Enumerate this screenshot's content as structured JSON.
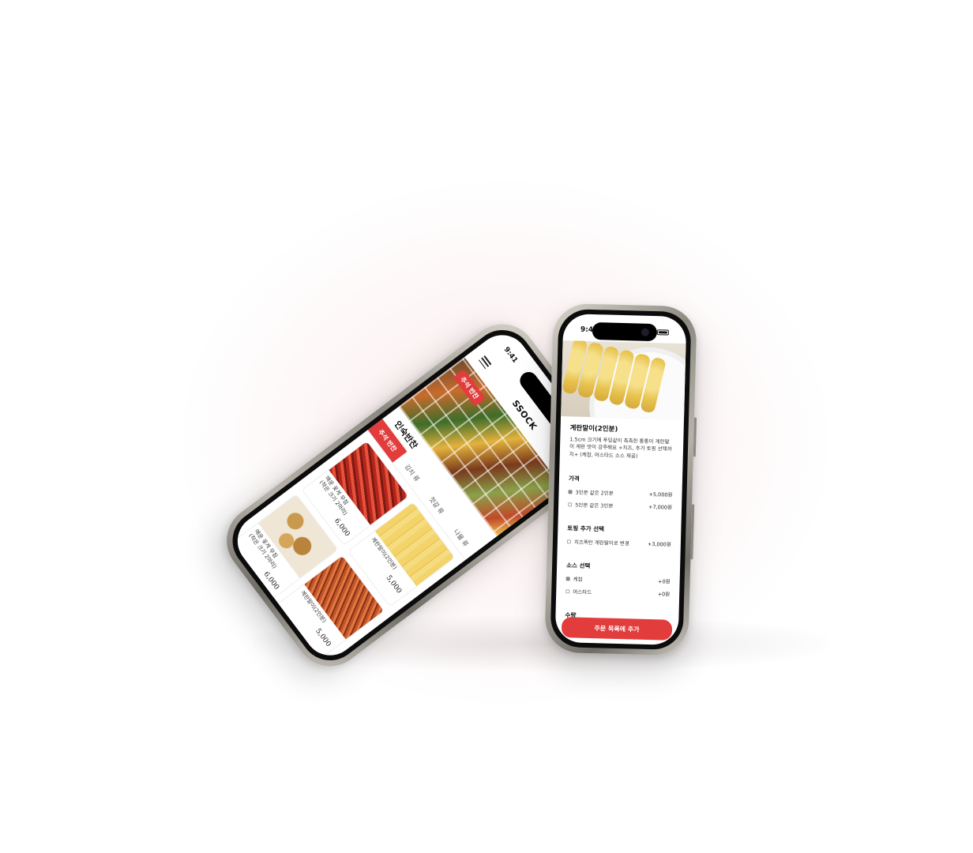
{
  "colors": {
    "accent": "#e23c3c",
    "phone_frame": "#8d8a82",
    "text": "#111111"
  },
  "left_phone": {
    "status_time": "9:41",
    "logo": "SSOCK",
    "store_name": "인숙반찬",
    "hero_tag": "추석 반찬",
    "tabs": [
      "추석 반찬",
      "김치 류",
      "젓갈 류",
      "나물 류"
    ],
    "products": [
      {
        "name": "매운 꽃게 무침\n(작은 크기 2마리)",
        "price": "6,000",
        "image": "spicy-crab"
      },
      {
        "name": "계란말이(2인분)",
        "price": "5,000",
        "image": "egg-roll"
      },
      {
        "name": "매운 꽃게 무침\n(작은 크기 2마리)",
        "price": "6,000",
        "image": "quail-eggs"
      },
      {
        "name": "계란말이(2인분)",
        "price": "5,000",
        "image": "squid"
      }
    ]
  },
  "right_phone": {
    "status_time": "9:41",
    "product_title": "계란말이(2인분)",
    "description": "1.5cm 크기에 푸딩같이 촉촉한 통통이 계란말이 계란 맛이 강주해요 +치즈, 추가 토핑 선택까지+ (케찹, 머스타드 소스 제공)",
    "sections": [
      {
        "title": "가격",
        "options": [
          {
            "label": "3인분 같은 2인분",
            "price": "+5,000원",
            "checked": true
          },
          {
            "label": "5인분 같은 3인분",
            "price": "+7,000원",
            "checked": false
          }
        ]
      },
      {
        "title": "토핑 추가 선택",
        "options": [
          {
            "label": "치즈폭탄 계란말이로 변경",
            "price": "+3,000원",
            "checked": false
          }
        ]
      },
      {
        "title": "소스 선택",
        "options": [
          {
            "label": "케찹",
            "price": "+0원",
            "checked": true
          },
          {
            "label": "머스타드",
            "price": "+0원",
            "checked": false
          }
        ]
      }
    ],
    "quantity_label": "수량",
    "cta_label": "주문 목록에 추가"
  }
}
